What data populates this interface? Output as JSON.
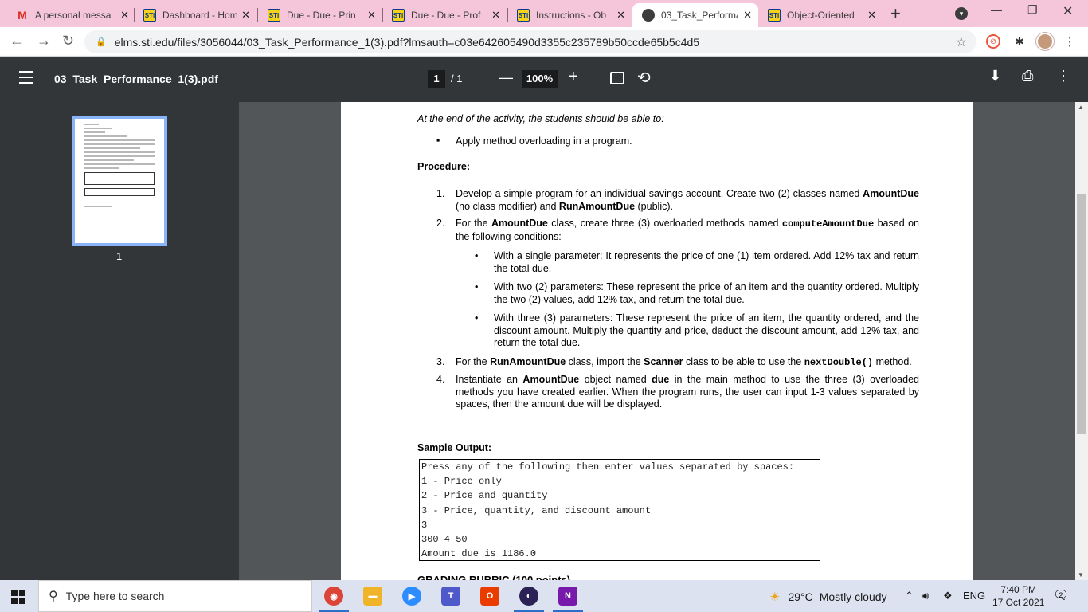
{
  "tabs": [
    {
      "title": "A personal messa",
      "favicon": "gmail"
    },
    {
      "title": "Dashboard - Hom",
      "favicon": "sti"
    },
    {
      "title": "Due - Due - Prin",
      "favicon": "sti"
    },
    {
      "title": "Due - Due - Prof",
      "favicon": "sti"
    },
    {
      "title": "Instructions - Ob",
      "favicon": "sti"
    },
    {
      "title": "03_Task_Performa",
      "favicon": "globe"
    },
    {
      "title": "Object-Oriented",
      "favicon": "sti"
    }
  ],
  "favicon_text": {
    "sti": "STI",
    "gmail": "M"
  },
  "newtab_label": "+",
  "close_label": "✕",
  "url": "elms.sti.edu/files/3056044/03_Task_Performance_1(3).pdf?lmsauth=c03e642605490d3355c235789b50ccde65b5c4d5",
  "pdf": {
    "filename": "03_Task_Performance_1(3).pdf",
    "page_current": "1",
    "page_total": "/ 1",
    "zoom": "100%",
    "thumbnail_label": "1"
  },
  "document": {
    "intro": "At the end of the activity, the students should be able to:",
    "objective": "Apply method overloading in a program.",
    "procedure_heading": "Procedure:",
    "step1": {
      "num": "1.",
      "t1": "Develop a simple program for an individual savings account. Create two (2) classes named ",
      "b1": "AmountDue",
      "t2": " (no class modifier) and ",
      "b2": "RunAmountDue",
      "t3": " (public)."
    },
    "step2": {
      "num": "2.",
      "t1": "For the ",
      "b1": "AmountDue",
      "t2": " class, create three (3) overloaded methods named ",
      "code": "computeAmountDue",
      "t3": " based on the following conditions:"
    },
    "conditions": [
      "With a single parameter: It represents the price of one (1) item ordered. Add 12% tax and return the total due.",
      "With two (2) parameters: These represent the price of an item and the quantity ordered. Multiply the two (2) values, add 12% tax, and return the total due.",
      "With three (3) parameters: These represent the price of an item, the quantity ordered, and the discount amount. Multiply the quantity and price, deduct the discount amount, add 12% tax, and return the total due."
    ],
    "step3": {
      "num": "3.",
      "t1": "For the ",
      "b1": "RunAmountDue",
      "t2": " class, import the ",
      "b2": "Scanner",
      "t3": " class to be able to use the ",
      "code": "nextDouble()",
      "t4": " method."
    },
    "step4": {
      "num": "4.",
      "t1": "Instantiate an ",
      "b1": "AmountDue",
      "t2": " object named ",
      "b2": "due",
      "t3": " in the main method to use the three (3) overloaded methods you have created earlier. When the program runs, the user can input 1-3 values separated by spaces, then the amount due will be displayed."
    },
    "sample_heading": "Sample Output:",
    "sample_output": [
      "Press any of the following then enter values separated by spaces:",
      "1 - Price only",
      "2 - Price and quantity",
      "3 - Price, quantity, and discount amount",
      "3",
      "300 4 50",
      "Amount due is 1186.0"
    ],
    "next_heading": "GRADING RUBRIC (100 points)"
  },
  "taskbar": {
    "search_placeholder": "Type here to search",
    "weather_temp": "29°C",
    "weather_desc": "Mostly cloudy",
    "language": "ENG",
    "time": "7:40 PM",
    "date": "17 Oct 2021",
    "notification_count": "2",
    "apps": [
      {
        "name": "chrome",
        "color": "#db4437",
        "glyph": "◉"
      },
      {
        "name": "file-explorer",
        "color": "#f0b429",
        "glyph": "▬"
      },
      {
        "name": "zoom",
        "color": "#2d8cff",
        "glyph": "▶"
      },
      {
        "name": "teams",
        "color": "#5059c9",
        "glyph": "T"
      },
      {
        "name": "office",
        "color": "#eb3c00",
        "glyph": "O"
      },
      {
        "name": "eclipse",
        "color": "#2c2255",
        "glyph": "◐"
      },
      {
        "name": "onenote",
        "color": "#7719aa",
        "glyph": "N"
      }
    ]
  }
}
